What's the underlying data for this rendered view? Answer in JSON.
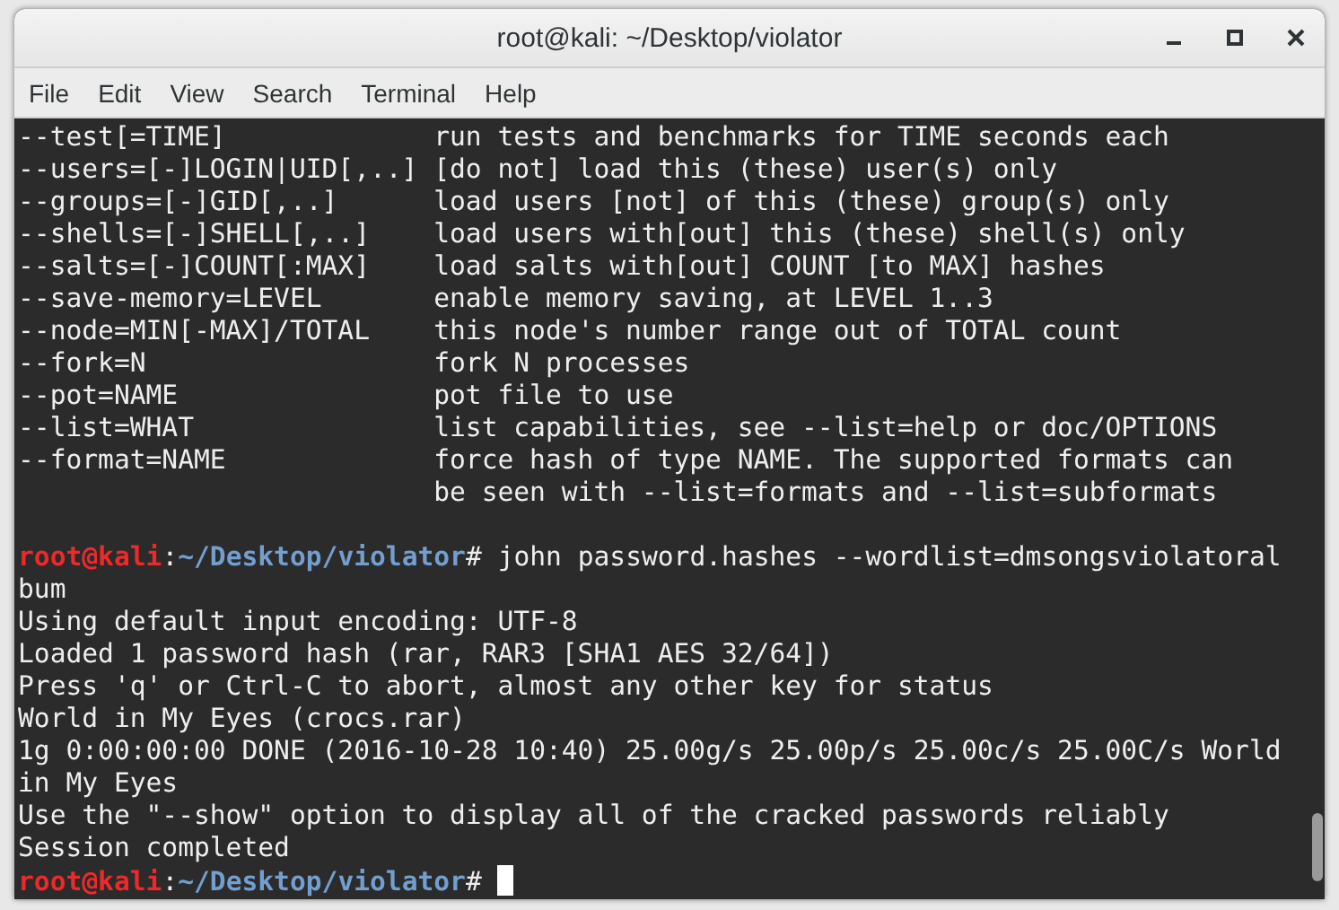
{
  "window": {
    "title": "root@kali: ~/Desktop/violator"
  },
  "menu": [
    "File",
    "Edit",
    "View",
    "Search",
    "Terminal",
    "Help"
  ],
  "terminal": {
    "lines": [
      {
        "kind": "option",
        "option": "--test[=TIME]",
        "description": "run tests and benchmarks for TIME seconds each"
      },
      {
        "kind": "option",
        "option": "--users=[-]LOGIN|UID[,..]",
        "description": "[do not] load this (these) user(s) only"
      },
      {
        "kind": "option",
        "option": "--groups=[-]GID[,..]",
        "description": "load users [not] of this (these) group(s) only"
      },
      {
        "kind": "option",
        "option": "--shells=[-]SHELL[,..]",
        "description": "load users with[out] this (these) shell(s) only"
      },
      {
        "kind": "option",
        "option": "--salts=[-]COUNT[:MAX]",
        "description": "load salts with[out] COUNT [to MAX] hashes"
      },
      {
        "kind": "option",
        "option": "--save-memory=LEVEL",
        "description": "enable memory saving, at LEVEL 1..3"
      },
      {
        "kind": "option",
        "option": "--node=MIN[-MAX]/TOTAL",
        "description": "this node's number range out of TOTAL count"
      },
      {
        "kind": "option",
        "option": "--fork=N",
        "description": "fork N processes"
      },
      {
        "kind": "option",
        "option": "--pot=NAME",
        "description": "pot file to use"
      },
      {
        "kind": "option",
        "option": "--list=WHAT",
        "description": "list capabilities, see --list=help or doc/OPTIONS"
      },
      {
        "kind": "option",
        "option": "--format=NAME",
        "description": "force hash of type NAME. The supported formats can"
      },
      {
        "kind": "option",
        "description": "be seen with --list=formats and --list=subformats"
      },
      {
        "kind": "blank"
      },
      {
        "kind": "prompt",
        "user": "root@kali",
        "separator": ":",
        "path": "~/Desktop/violator",
        "symbol": "#",
        "command": "john password.hashes --wordlist=dmsongsviolatoralbum"
      },
      {
        "kind": "output",
        "text": "Using default input encoding: UTF-8"
      },
      {
        "kind": "output",
        "text": "Loaded 1 password hash (rar, RAR3 [SHA1 AES 32/64])"
      },
      {
        "kind": "output",
        "text": "Press 'q' or Ctrl-C to abort, almost any other key for status"
      },
      {
        "kind": "output",
        "text": "World in My Eyes (crocs.rar)"
      },
      {
        "kind": "output",
        "text": "1g 0:00:00:00 DONE (2016-10-28 10:40) 25.00g/s 25.00p/s 25.00c/s 25.00C/s World in My Eyes"
      },
      {
        "kind": "output",
        "text": "Use the \"--show\" option to display all of the cracked passwords reliably"
      },
      {
        "kind": "output",
        "text": "Session completed"
      },
      {
        "kind": "prompt",
        "user": "root@kali",
        "separator": ":",
        "path": "~/Desktop/violator",
        "symbol": "#",
        "cursor": true
      }
    ]
  }
}
